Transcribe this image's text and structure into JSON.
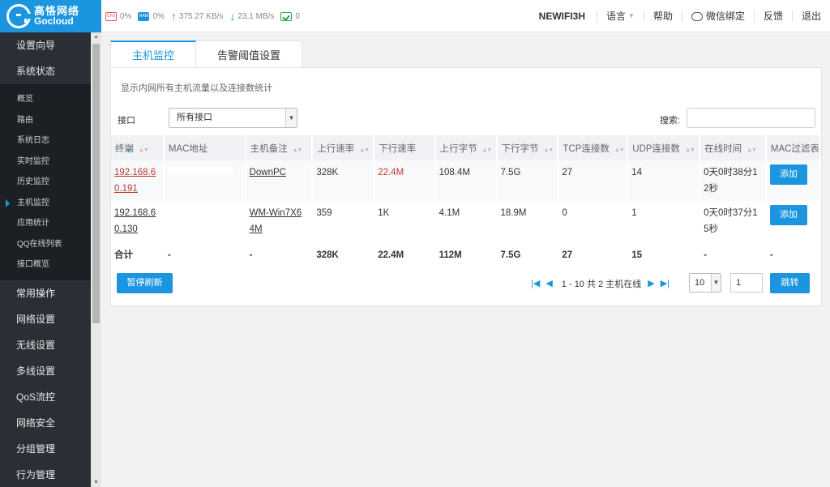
{
  "brand": {
    "name_cn": "高恪网络",
    "name_en": "Gocloud",
    "color": "#1b95e0"
  },
  "status": {
    "cpu_label": "CPU",
    "cpu": "0%",
    "ram_label": "RAM",
    "ram": "0%",
    "upload": "375.27 KB/s",
    "download": "23.1 MB/s",
    "network_count": "0"
  },
  "topnav": {
    "device_name": "NEWIFI3H",
    "language": "语言",
    "help": "帮助",
    "wechat_bind": "微信绑定",
    "feedback": "反馈",
    "logout": "退出"
  },
  "sidebar": {
    "top_items": [
      {
        "label": "设置向导"
      },
      {
        "label": "系统状态"
      }
    ],
    "sub_items": [
      {
        "label": "概览"
      },
      {
        "label": "路由"
      },
      {
        "label": "系统日志"
      },
      {
        "label": "实时监控"
      },
      {
        "label": "历史监控"
      },
      {
        "label": "主机监控",
        "active": true
      },
      {
        "label": "应用统计"
      },
      {
        "label": "QQ在线列表"
      },
      {
        "label": "接口概览"
      }
    ],
    "bottom_items": [
      {
        "label": "常用操作"
      },
      {
        "label": "网络设置"
      },
      {
        "label": "无线设置"
      },
      {
        "label": "多线设置"
      },
      {
        "label": "QoS流控"
      },
      {
        "label": "网络安全"
      },
      {
        "label": "分组管理"
      },
      {
        "label": "行为管理"
      }
    ]
  },
  "tabs": [
    {
      "label": "主机监控",
      "active": true
    },
    {
      "label": "告警阈值设置",
      "active": false
    }
  ],
  "panel": {
    "description": "显示内网所有主机流量以及连接数统计",
    "interface_label": "接口",
    "interface_value": "所有接口",
    "search_label": "搜索:",
    "search_value": ""
  },
  "table": {
    "headers": [
      "终端",
      "MAC地址",
      "主机备注",
      "上行速率",
      "下行速率",
      "上行字节",
      "下行字节",
      "TCP连接数",
      "UDP连接数",
      "在线时间",
      "MAC过滤表"
    ],
    "rows": [
      {
        "ip": "192.168.6\n0.191",
        "mac": "",
        "remark": "DownPC",
        "up_rate": "328K",
        "down_rate": "22.4M",
        "up_bytes": "108.4M",
        "down_bytes": "7.5G",
        "tcp": "27",
        "udp": "14",
        "online": "0天0时38分1\n2秒",
        "action": "添加"
      },
      {
        "ip": "192.168.6\n0.130",
        "mac": "",
        "remark": "WM-Win7X6\n4M",
        "up_rate": "359",
        "down_rate": "1K",
        "up_bytes": "4.1M",
        "down_bytes": "18.9M",
        "tcp": "0",
        "udp": "1",
        "online": "0天0时37分1\n5秒",
        "action": "添加"
      }
    ],
    "total": {
      "label": "合计",
      "mac": "-",
      "remark": "-",
      "up_rate": "328K",
      "down_rate": "22.4M",
      "up_bytes": "112M",
      "down_bytes": "7.5G",
      "tcp": "27",
      "udp": "15",
      "online": "-",
      "action": "-"
    }
  },
  "footer": {
    "pause_label": "暂停刷新",
    "pager_text": "1 - 10 共 2 主机在线",
    "page_size": "10",
    "page_number": "1",
    "jump_label": "跳转"
  }
}
